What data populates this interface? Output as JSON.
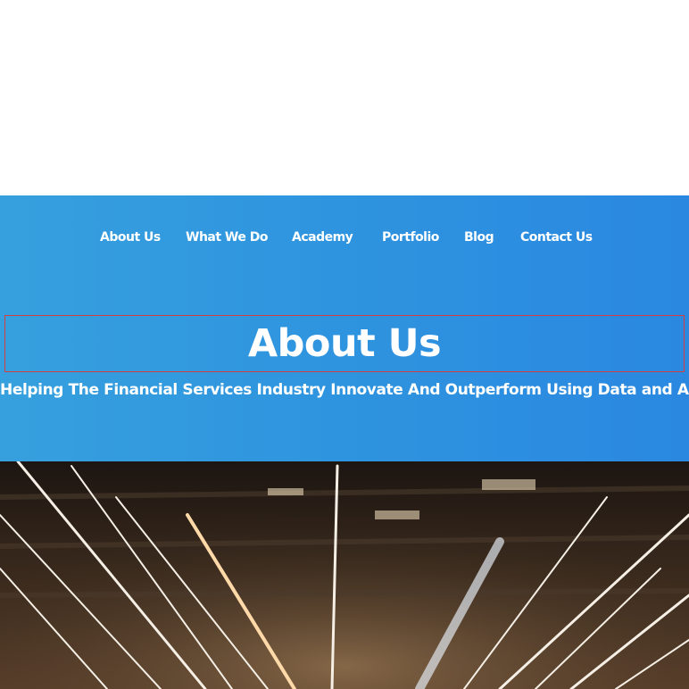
{
  "nav": {
    "items": [
      {
        "label": "About Us"
      },
      {
        "label": "What We Do"
      },
      {
        "label": "Academy"
      },
      {
        "label": "Portfolio"
      },
      {
        "label": "Blog"
      },
      {
        "label": "Contact Us"
      }
    ]
  },
  "hero": {
    "title": "About Us",
    "subtitle": "Helping The Financial Services Industry Innovate And Outperform Using Data and AI"
  },
  "photo": {
    "icon": "light-trails-image"
  },
  "colors": {
    "hero_start": "#36a0de",
    "hero_end": "#2a88e0",
    "text": "#ffffff",
    "title_outline": "#d04040"
  }
}
